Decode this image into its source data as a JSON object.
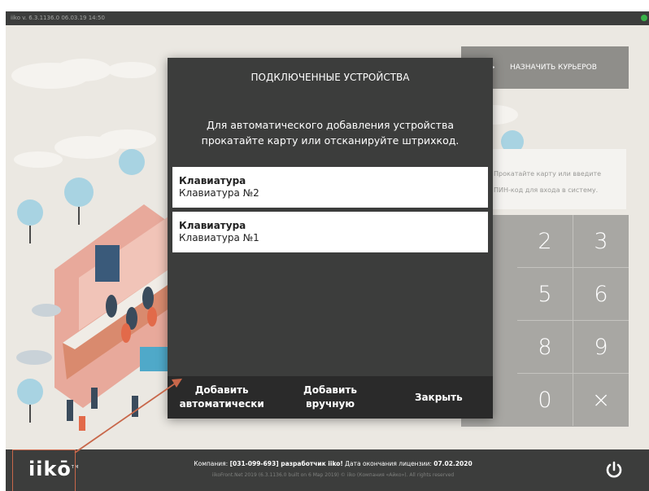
{
  "app": {
    "version_info": "iiko  v. 6.3.1136.0    06.03.19   14:50",
    "brand": "iikō",
    "trademark": "TM"
  },
  "courier": {
    "label": "НАЗНАЧИТЬ КУРЬЕРОВ",
    "icon": "delivery-truck-icon"
  },
  "login_hint": {
    "line1": "Прокатайте карту или введите",
    "line2": "ПИН-код для входа в систему."
  },
  "keypad": {
    "keys": [
      "2",
      "3",
      "5",
      "6",
      "8",
      "9",
      "0",
      "×"
    ]
  },
  "dialog": {
    "title": "ПОДКЛЮЧЕННЫЕ УСТРОЙСТВА",
    "message": "Для автоматического добавления устройства прокатайте карту или отсканируйте штрихкод.",
    "devices": [
      {
        "name": "Клавиатура",
        "detail": "Клавиатура №2"
      },
      {
        "name": "Клавиатура",
        "detail": "Клавиатура №1"
      }
    ],
    "buttons": {
      "add_auto_1": "Добавить",
      "add_auto_2": "автоматически",
      "add_manual_1": "Добавить",
      "add_manual_2": "вручную",
      "close": "Закрыть"
    }
  },
  "footer": {
    "license_prefix": "Компания: ",
    "license_company": "[031-099-693] разработчик iiko!",
    "license_mid": " Дата окончания лицензии: ",
    "license_date": "07.02.2020",
    "copyright": "iikoFront.Net 2019 (6.3.1136.0 built on 6 Мар 2019) © iiko (Компания «Айко»). All rights reserved"
  },
  "colors": {
    "dark_bar": "#3c3d3c",
    "dialog_bg": "#3c3d3c",
    "footer_bg": "#2a2a2a",
    "keypad_bg": "#a8a7a3",
    "annotation": "#c8674a",
    "status_green": "#3bb44a"
  }
}
